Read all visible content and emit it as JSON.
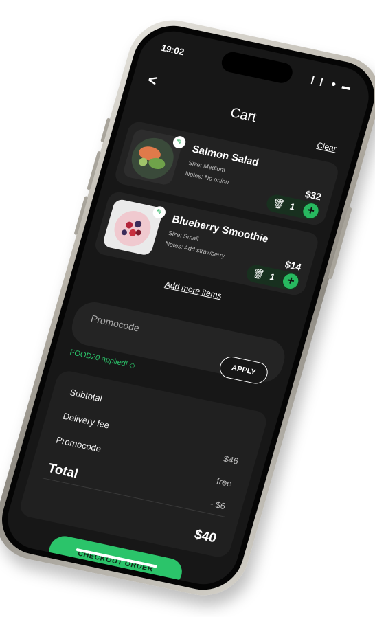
{
  "status_bar": {
    "time": "19:02",
    "icons": "❙❙  ●  ▬"
  },
  "header": {
    "back": "<",
    "title": "Cart",
    "clear": "Clear"
  },
  "cart": {
    "items": [
      {
        "name": "Salmon Salad",
        "size": "Size: Medium",
        "notes": "Notes: No onion",
        "price": "$32",
        "qty": "1"
      },
      {
        "name": "Blueberry Smoothie",
        "size": "Size: Small",
        "notes": "Notes: Add strawberry",
        "price": "$14",
        "qty": "1"
      }
    ],
    "add_more": "Add more items"
  },
  "promo": {
    "placeholder": "Promocode",
    "apply_label": "APPLY",
    "applied_text": "FOOD20 applied! ◇"
  },
  "summary": {
    "subtotal_label": "Subtotal",
    "delivery_label": "Delivery fee",
    "promocode_label": "Promocode",
    "total_label": "Total",
    "subtotal_value": "$46",
    "delivery_value": "free",
    "promocode_value": "- $6",
    "total_value": "$40"
  },
  "checkout_label": "CHECKOUT ORDER",
  "colors": {
    "accent": "#2bc46a",
    "background": "#171717",
    "card": "#222222"
  }
}
